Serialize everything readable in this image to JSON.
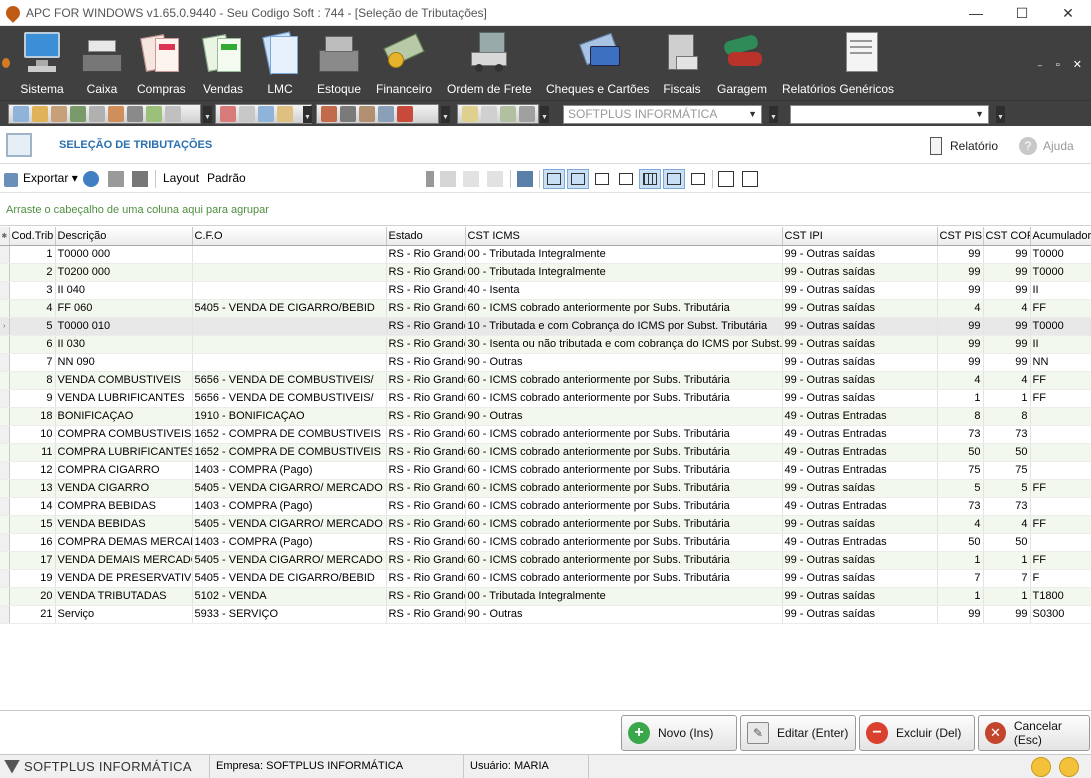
{
  "window": {
    "title": "APC FOR WINDOWS v1.65.0.9440 - Seu Codigo Soft : 744  - [Seleção de Tributações]",
    "minimize": "—",
    "maximize": "☐",
    "close": "✕"
  },
  "ribbon": {
    "items": [
      {
        "label": "Sistema",
        "icon": "computer-icon"
      },
      {
        "label": "Caixa",
        "icon": "cash-register-icon"
      },
      {
        "label": "Compras",
        "icon": "purchases-icon"
      },
      {
        "label": "Vendas",
        "icon": "sales-icon"
      },
      {
        "label": "LMC",
        "icon": "document-icon"
      },
      {
        "label": "Estoque",
        "icon": "stock-icon"
      },
      {
        "label": "Financeiro",
        "icon": "money-icon"
      },
      {
        "label": "Ordem de Frete",
        "icon": "truck-icon"
      },
      {
        "label": "Cheques e Cartões",
        "icon": "card-icon"
      },
      {
        "label": "Fiscais",
        "icon": "fiscal-icon"
      },
      {
        "label": "Garagem",
        "icon": "car-icon"
      },
      {
        "label": "Relatórios Genéricos",
        "icon": "report-icon"
      }
    ],
    "window_controls": "₋ ▫ ✕"
  },
  "quicktools": {
    "company_select": "SOFTPLUS INFORMÁTICA",
    "second_select": ""
  },
  "header": {
    "title": "SELEÇÃO DE TRIBUTAÇÕES",
    "report": "Relatório",
    "help": "Ajuda"
  },
  "grid_toolbar": {
    "export": "Exportar",
    "layout": "Layout",
    "layout_value": "Padrão"
  },
  "group_hint": "Arraste o cabeçalho de uma coluna aqui para agrupar",
  "table": {
    "columns": [
      "Cod.Trib",
      "Descrição",
      "C.F.O",
      "Estado",
      "CST ICMS",
      "CST IPI",
      "CST PIS",
      "CST COF",
      "Acumulador"
    ],
    "rows": [
      [
        "1",
        "T0000 000",
        "",
        "RS - Rio Grande",
        "00 - Tributada Integralmente",
        "99 - Outras saídas",
        "99",
        "99",
        "T0000"
      ],
      [
        "2",
        "T0200 000",
        "",
        "RS - Rio Grande",
        "00 - Tributada Integralmente",
        "99 - Outras saídas",
        "99",
        "99",
        "T0000"
      ],
      [
        "3",
        "II 040",
        "",
        "RS - Rio Grande",
        "40 - Isenta",
        "99 - Outras saídas",
        "99",
        "99",
        "II"
      ],
      [
        "4",
        "FF 060",
        "5405  - VENDA DE CIGARRO/BEBID",
        "RS - Rio Grande",
        "60 - ICMS cobrado anteriormente por Subs. Tributária",
        "99 - Outras saídas",
        "4",
        "4",
        "FF"
      ],
      [
        "5",
        "T0000 010",
        "",
        "RS - Rio Grande",
        "10 - Tributada e com Cobrança do ICMS por Subst. Tributária",
        "99 - Outras saídas",
        "99",
        "99",
        "T0000"
      ],
      [
        "6",
        "II 030",
        "",
        "RS - Rio Grande",
        "30 - Isenta ou não tributada e com cobrança do ICMS por Subst.",
        "99 - Outras saídas",
        "99",
        "99",
        "II"
      ],
      [
        "7",
        "NN 090",
        "",
        "RS - Rio Grande",
        "90 - Outras",
        "99 - Outras saídas",
        "99",
        "99",
        "NN"
      ],
      [
        "8",
        "VENDA COMBUSTIVEIS",
        "5656  - VENDA DE COMBUSTIVEIS/",
        "RS - Rio Grande",
        "60 - ICMS cobrado anteriormente por Subs. Tributária",
        "99 - Outras saídas",
        "4",
        "4",
        "FF"
      ],
      [
        "9",
        "VENDA LUBRIFICANTES",
        "5656  - VENDA DE COMBUSTIVEIS/",
        "RS - Rio Grande",
        "60 - ICMS cobrado anteriormente por Subs. Tributária",
        "99 - Outras saídas",
        "1",
        "1",
        "FF"
      ],
      [
        "18",
        "BONIFICAÇAO",
        "1910  - BONIFICAÇAO",
        "RS - Rio Grande",
        "90 - Outras",
        "49 - Outras Entradas",
        "8",
        "8",
        ""
      ],
      [
        "10",
        "COMPRA COMBUSTIVEIS",
        "1652  - COMPRA DE COMBUSTIVEIS",
        "RS - Rio Grande",
        "60 - ICMS cobrado anteriormente por Subs. Tributária",
        "49 - Outras Entradas",
        "73",
        "73",
        ""
      ],
      [
        "11",
        "COMPRA LUBRIFICANTES",
        "1652  - COMPRA DE COMBUSTIVEIS",
        "RS - Rio Grande",
        "60 - ICMS cobrado anteriormente por Subs. Tributária",
        "49 - Outras Entradas",
        "50",
        "50",
        ""
      ],
      [
        "12",
        "COMPRA CIGARRO",
        "1403  - COMPRA (Pago)",
        "RS - Rio Grande",
        "60 - ICMS cobrado anteriormente por Subs. Tributária",
        "49 - Outras Entradas",
        "75",
        "75",
        ""
      ],
      [
        "13",
        "VENDA CIGARRO",
        "5405  - VENDA CIGARRO/ MERCADO",
        "RS - Rio Grande",
        "60 - ICMS cobrado anteriormente por Subs. Tributária",
        "99 - Outras saídas",
        "5",
        "5",
        "FF"
      ],
      [
        "14",
        "COMPRA BEBIDAS",
        "1403  - COMPRA (Pago)",
        "RS - Rio Grande",
        "60 - ICMS cobrado anteriormente por Subs. Tributária",
        "49 - Outras Entradas",
        "73",
        "73",
        ""
      ],
      [
        "15",
        "VENDA BEBIDAS",
        "5405  - VENDA CIGARRO/ MERCADO",
        "RS - Rio Grande",
        "60 - ICMS cobrado anteriormente por Subs. Tributária",
        "99 - Outras saídas",
        "4",
        "4",
        "FF"
      ],
      [
        "16",
        "COMPRA DEMAS MERCADO",
        "1403  - COMPRA (Pago)",
        "RS - Rio Grande",
        "60 - ICMS cobrado anteriormente por Subs. Tributária",
        "49 - Outras Entradas",
        "50",
        "50",
        ""
      ],
      [
        "17",
        "VENDA DEMAIS MERCADOR",
        "5405  - VENDA CIGARRO/ MERCADO",
        "RS - Rio Grande",
        "60 - ICMS cobrado anteriormente por Subs. Tributária",
        "99 - Outras saídas",
        "1",
        "1",
        "FF"
      ],
      [
        "19",
        "VENDA DE PRESERVATIVO",
        "5405  - VENDA DE CIGARRO/BEBID",
        "RS - Rio Grande",
        "60 - ICMS cobrado anteriormente por Subs. Tributária",
        "99 - Outras saídas",
        "7",
        "7",
        "F"
      ],
      [
        "20",
        "VENDA TRIBUTADAS",
        "5102  - VENDA",
        "RS - Rio Grande",
        "00 - Tributada Integralmente",
        "99 - Outras saídas",
        "1",
        "1",
        "T1800"
      ],
      [
        "21",
        "Serviço",
        "5933  - SERVIÇO",
        "RS - Rio Grande",
        "90 - Outras",
        "99 - Outras saídas",
        "99",
        "99",
        "S0300"
      ]
    ]
  },
  "actions": {
    "new": "Novo (Ins)",
    "edit": "Editar (Enter)",
    "delete": "Excluir (Del)",
    "cancel": "Cancelar (Esc)"
  },
  "status": {
    "brand": "SOFTPLUS INFORMÁTICA",
    "company": "Empresa: SOFTPLUS INFORMÁTICA",
    "user": "Usuário: MARIA"
  }
}
